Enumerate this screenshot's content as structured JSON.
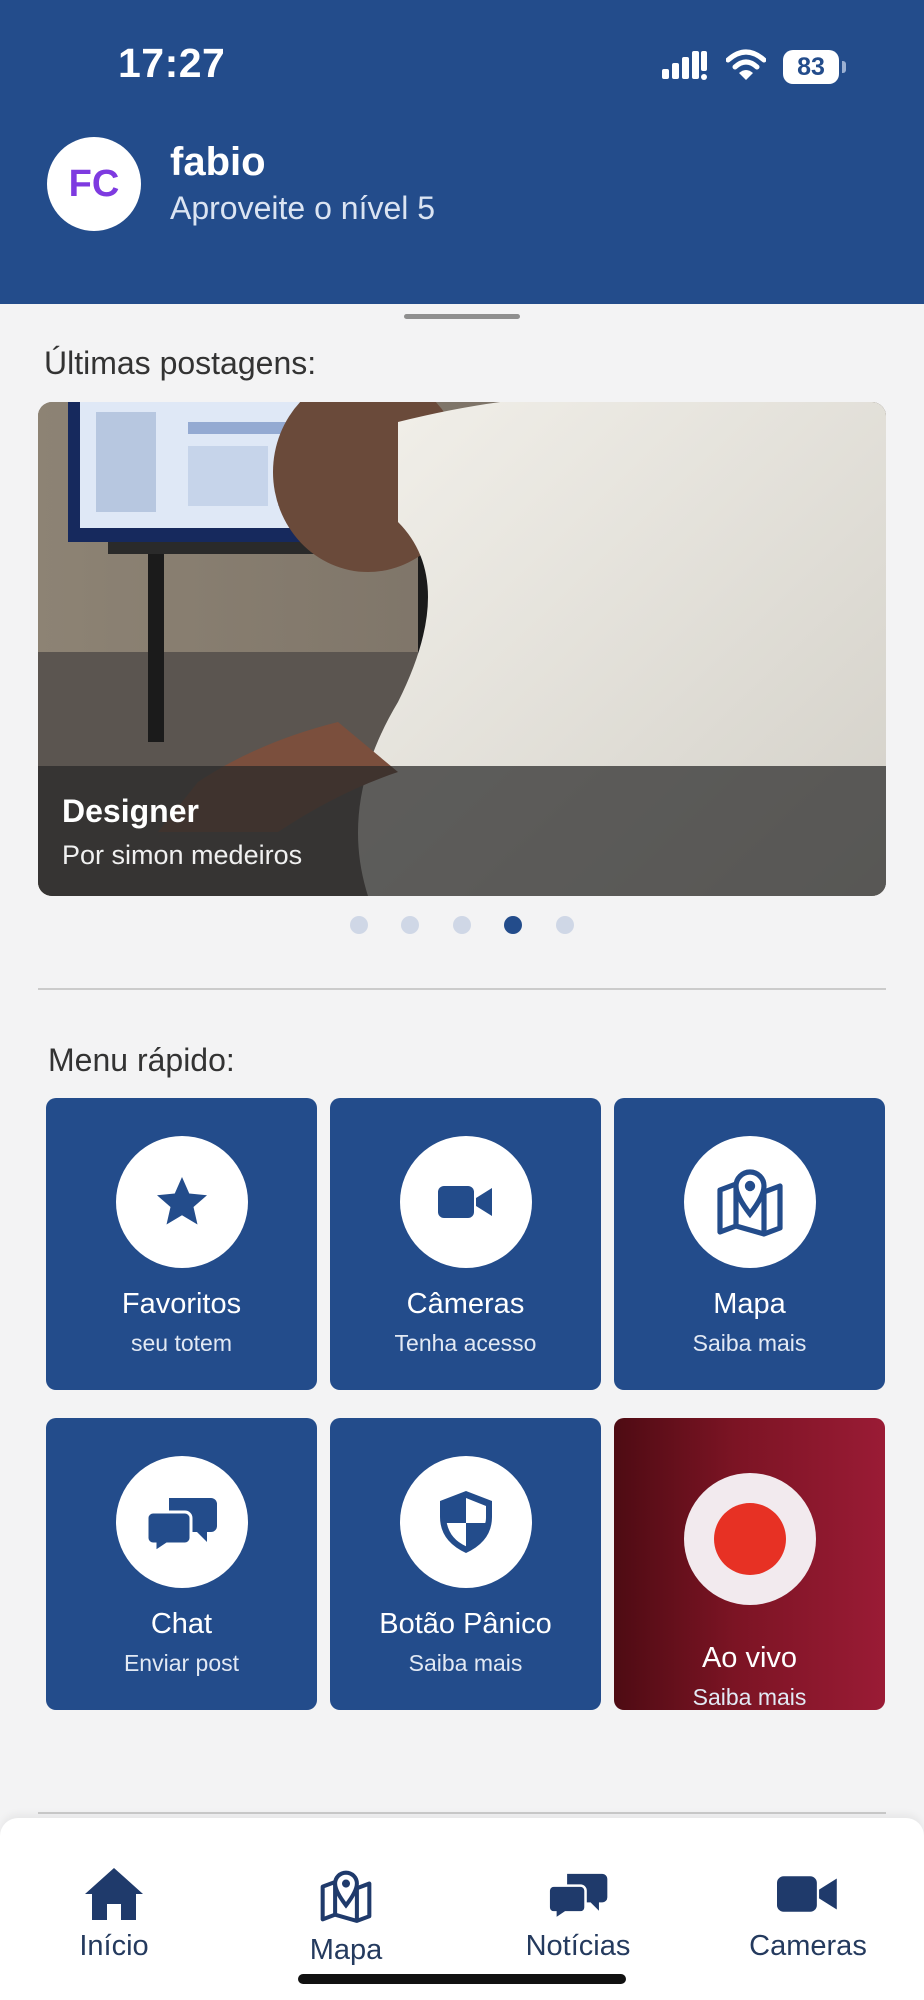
{
  "status_bar": {
    "time": "17:27",
    "battery": "83",
    "icons": [
      "cellular-signal-icon",
      "wifi-icon",
      "battery-icon"
    ]
  },
  "header": {
    "avatar_initials": "FC",
    "user_name": "fabio",
    "subtitle": "Aproveite o nível 5"
  },
  "latest_posts": {
    "title": "Últimas postagens:",
    "post": {
      "title": "Designer",
      "author": "Por simon medeiros"
    },
    "pagination": {
      "total": 5,
      "active_index": 4
    }
  },
  "quick_menu": {
    "title": "Menu rápido:",
    "items": [
      {
        "label": "Favoritos",
        "sub": "seu totem",
        "icon": "star-icon"
      },
      {
        "label": "Câmeras",
        "sub": "Tenha acesso",
        "icon": "video-camera-icon"
      },
      {
        "label": "Mapa",
        "sub": "Saiba mais",
        "icon": "map-pin-icon"
      },
      {
        "label": "Chat",
        "sub": "Enviar post",
        "icon": "chat-bubbles-icon"
      },
      {
        "label": "Botão Pânico",
        "sub": "Saiba mais",
        "icon": "shield-icon"
      },
      {
        "label": "Ao vivo",
        "sub": "Saiba mais",
        "icon": "record-icon"
      }
    ]
  },
  "bottom_nav": {
    "items": [
      {
        "label": "Início",
        "icon": "home-icon"
      },
      {
        "label": "Mapa",
        "icon": "map-pin-icon"
      },
      {
        "label": "Notícias",
        "icon": "chat-bubbles-icon"
      },
      {
        "label": "Cameras",
        "icon": "video-camera-icon"
      }
    ]
  },
  "colors": {
    "primary": "#234c8b",
    "background": "#f3f3f4",
    "live_gradient_start": "#4e0b13",
    "live_gradient_end": "#9a1b35",
    "record_red": "#e73124",
    "avatar_text": "#7e3ae0"
  }
}
